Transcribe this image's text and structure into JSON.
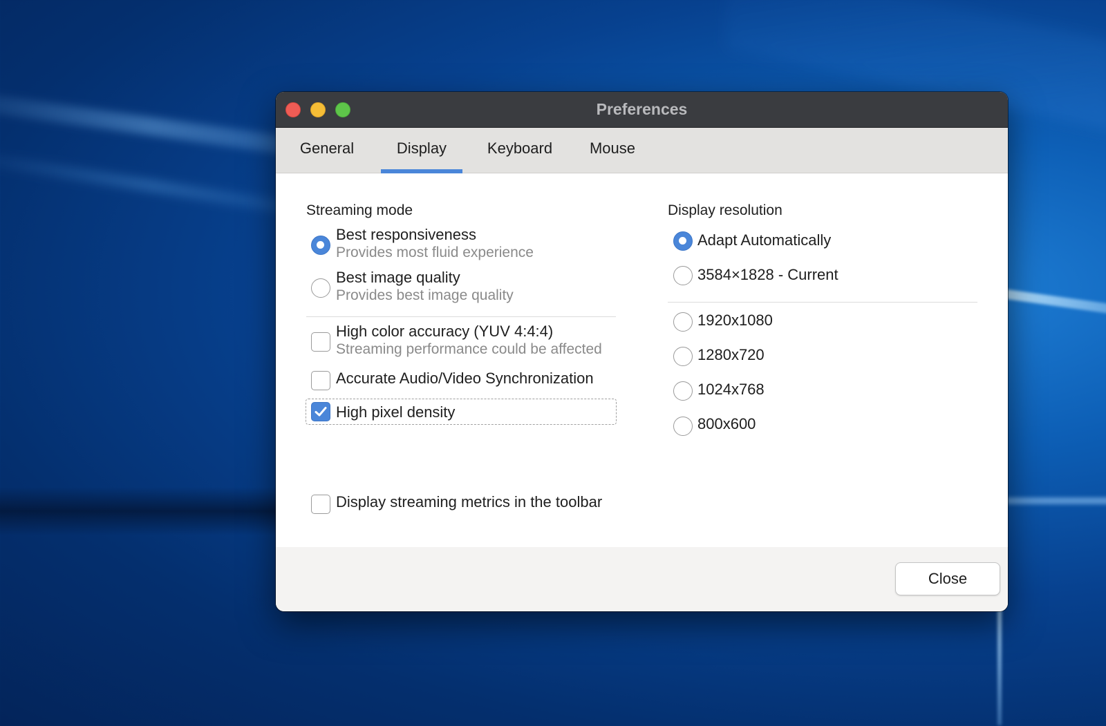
{
  "window": {
    "title": "Preferences"
  },
  "tabs": [
    {
      "label": "General",
      "active": false
    },
    {
      "label": "Display",
      "active": true
    },
    {
      "label": "Keyboard",
      "active": false
    },
    {
      "label": "Mouse",
      "active": false
    }
  ],
  "streaming": {
    "label": "Streaming mode",
    "options": [
      {
        "label": "Best responsiveness",
        "sublabel": "Provides most fluid experience",
        "selected": true
      },
      {
        "label": "Best image quality",
        "sublabel": "Provides best image quality",
        "selected": false
      }
    ]
  },
  "checkboxes": [
    {
      "label": "High color accuracy (YUV 4:4:4)",
      "sublabel": "Streaming performance could be affected",
      "checked": false
    },
    {
      "label": "Accurate Audio/Video Synchronization",
      "checked": false
    },
    {
      "label": "High pixel density",
      "checked": true
    },
    {
      "label": "Display streaming metrics in the toolbar",
      "checked": false
    }
  ],
  "resolution": {
    "label": "Display resolution",
    "options": [
      {
        "label": "Adapt Automatically",
        "selected": true
      },
      {
        "label": "3584×1828 - Current",
        "selected": false
      },
      {
        "label": "1920x1080",
        "selected": false
      },
      {
        "label": "1280x720",
        "selected": false
      },
      {
        "label": "1024x768",
        "selected": false
      },
      {
        "label": "800x600",
        "selected": false
      }
    ]
  },
  "footer": {
    "close_label": "Close"
  },
  "colors": {
    "accent": "#4a86d9",
    "titlebar": "#3a3c40",
    "tabbar": "#e3e2e0"
  }
}
